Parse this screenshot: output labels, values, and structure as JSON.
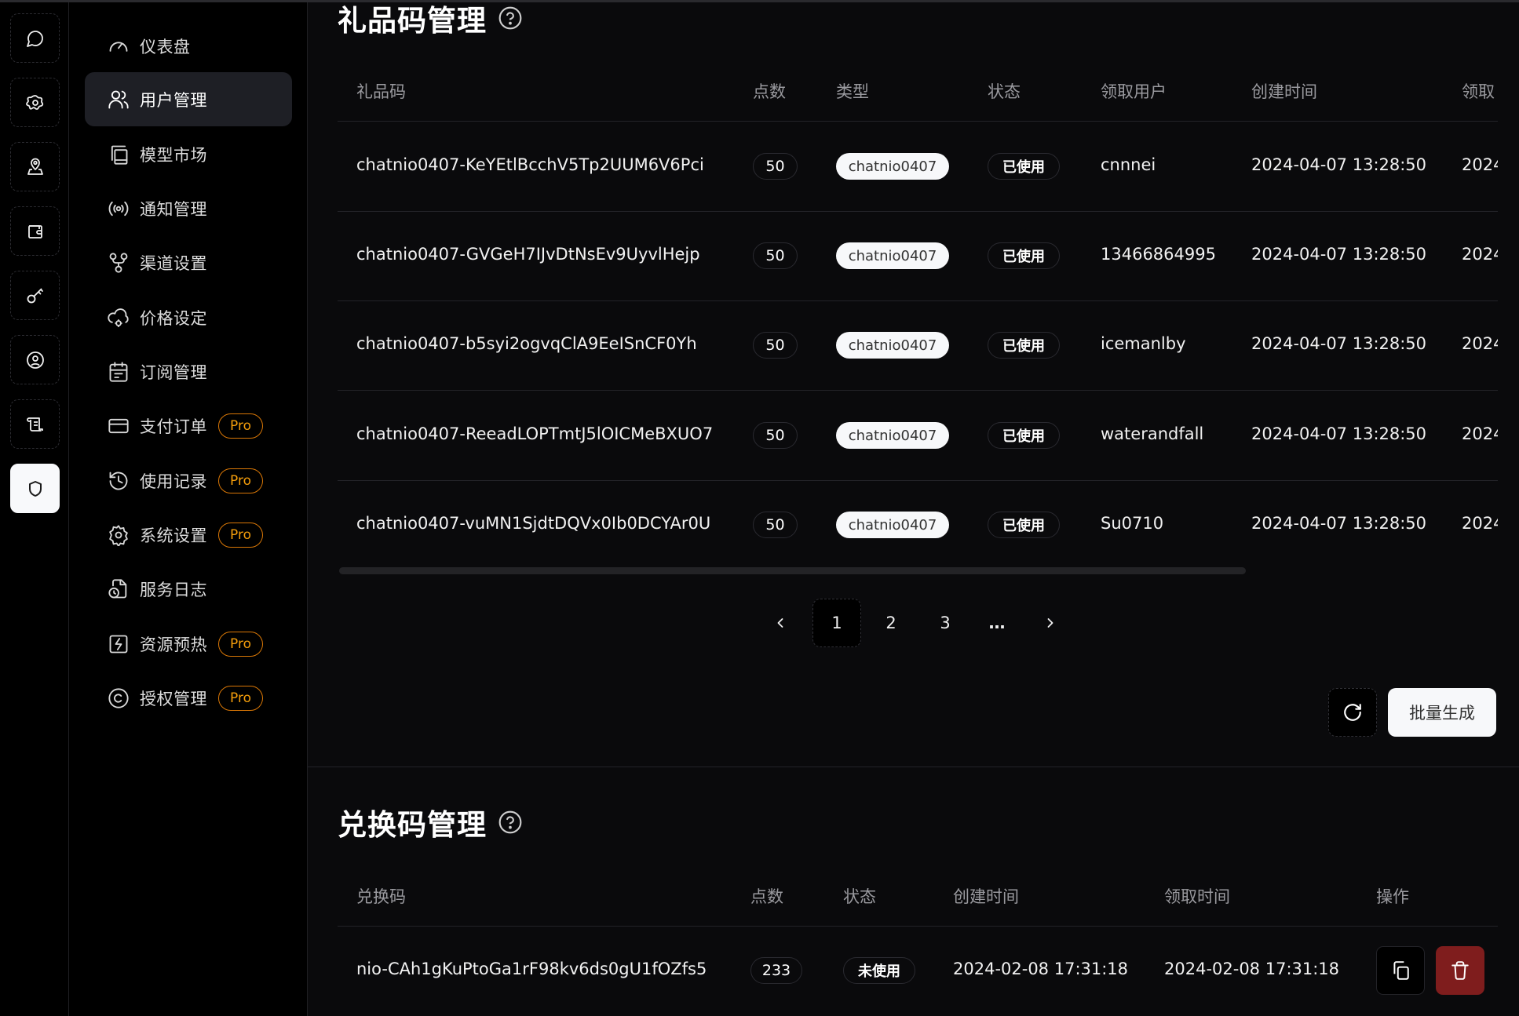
{
  "rail": {
    "items": [
      {
        "icon": "chat-bubble-icon",
        "active": false
      },
      {
        "icon": "settings-flower-icon",
        "active": false
      },
      {
        "icon": "map-pin-user-icon",
        "active": false
      },
      {
        "icon": "wallet-icon",
        "active": false
      },
      {
        "icon": "key-icon",
        "active": false
      },
      {
        "icon": "user-circle-icon",
        "active": false
      },
      {
        "icon": "scroll-icon",
        "active": false
      },
      {
        "icon": "shield-icon",
        "active": true
      }
    ]
  },
  "sidebar": {
    "items": [
      {
        "label": "仪表盘",
        "icon": "gauge-icon",
        "pro": false,
        "active": false
      },
      {
        "label": "用户管理",
        "icon": "users-icon",
        "pro": false,
        "active": true
      },
      {
        "label": "模型市场",
        "icon": "book-copy-icon",
        "pro": false,
        "active": false
      },
      {
        "label": "通知管理",
        "icon": "radio-broadcast-icon",
        "pro": false,
        "active": false
      },
      {
        "label": "渠道设置",
        "icon": "network-icon",
        "pro": false,
        "active": false
      },
      {
        "label": "价格设定",
        "icon": "cloud-cog-icon",
        "pro": false,
        "active": false
      },
      {
        "label": "订阅管理",
        "icon": "calendar-icon",
        "pro": false,
        "active": false
      },
      {
        "label": "支付订单",
        "icon": "credit-card-icon",
        "pro": true,
        "active": false
      },
      {
        "label": "使用记录",
        "icon": "history-icon",
        "pro": true,
        "active": false
      },
      {
        "label": "系统设置",
        "icon": "gear-icon",
        "pro": true,
        "active": false
      },
      {
        "label": "服务日志",
        "icon": "file-clock-icon",
        "pro": false,
        "active": false
      },
      {
        "label": "资源预热",
        "icon": "bolt-box-icon",
        "pro": true,
        "active": false
      },
      {
        "label": "授权管理",
        "icon": "copyright-icon",
        "pro": true,
        "active": false
      }
    ],
    "pro_label": "Pro"
  },
  "gift": {
    "title": "礼品码管理",
    "columns": [
      "礼品码",
      "点数",
      "类型",
      "状态",
      "领取用户",
      "创建时间",
      "领取"
    ],
    "rows": [
      {
        "code": "chatnio0407-KeYEtlBcchV5Tp2UUM6V6Pci",
        "points": "50",
        "type": "chatnio0407",
        "status": "已使用",
        "user": "cnnnei",
        "created": "2024-04-07 13:28:50",
        "claimed": "2024"
      },
      {
        "code": "chatnio0407-GVGeH7IJvDtNsEv9UyvlHejp",
        "points": "50",
        "type": "chatnio0407",
        "status": "已使用",
        "user": "13466864995",
        "created": "2024-04-07 13:28:50",
        "claimed": "2024"
      },
      {
        "code": "chatnio0407-b5syi2ogvqClA9EeISnCF0Yh",
        "points": "50",
        "type": "chatnio0407",
        "status": "已使用",
        "user": "icemanlby",
        "created": "2024-04-07 13:28:50",
        "claimed": "2024"
      },
      {
        "code": "chatnio0407-ReeadLOPTmtJ5lOICMeBXUO7",
        "points": "50",
        "type": "chatnio0407",
        "status": "已使用",
        "user": "waterandfall",
        "created": "2024-04-07 13:28:50",
        "claimed": "2024"
      },
      {
        "code": "chatnio0407-vuMN1SjdtDQVx0Ib0DCYAr0U",
        "points": "50",
        "type": "chatnio0407",
        "status": "已使用",
        "user": "Su0710",
        "created": "2024-04-07 13:28:50",
        "claimed": "2024"
      }
    ],
    "pagination": {
      "pages": [
        "1",
        "2",
        "3",
        "…"
      ],
      "current": "1"
    },
    "actions": {
      "generate_label": "批量生成"
    }
  },
  "redeem": {
    "title": "兑换码管理",
    "columns": [
      "兑换码",
      "点数",
      "状态",
      "创建时间",
      "领取时间",
      "操作"
    ],
    "rows": [
      {
        "code": "nio-CAh1gKuPtoGa1rF98kv6ds0gU1fOZfs5",
        "points": "233",
        "status": "未使用",
        "created": "2024-02-08 17:31:18",
        "claimed": "2024-02-08 17:31:18"
      }
    ]
  },
  "colors": {
    "accent_pro": "#f59e0b",
    "delete_button": "#7f1d1d",
    "active_menu_bg": "#1e1f25"
  }
}
